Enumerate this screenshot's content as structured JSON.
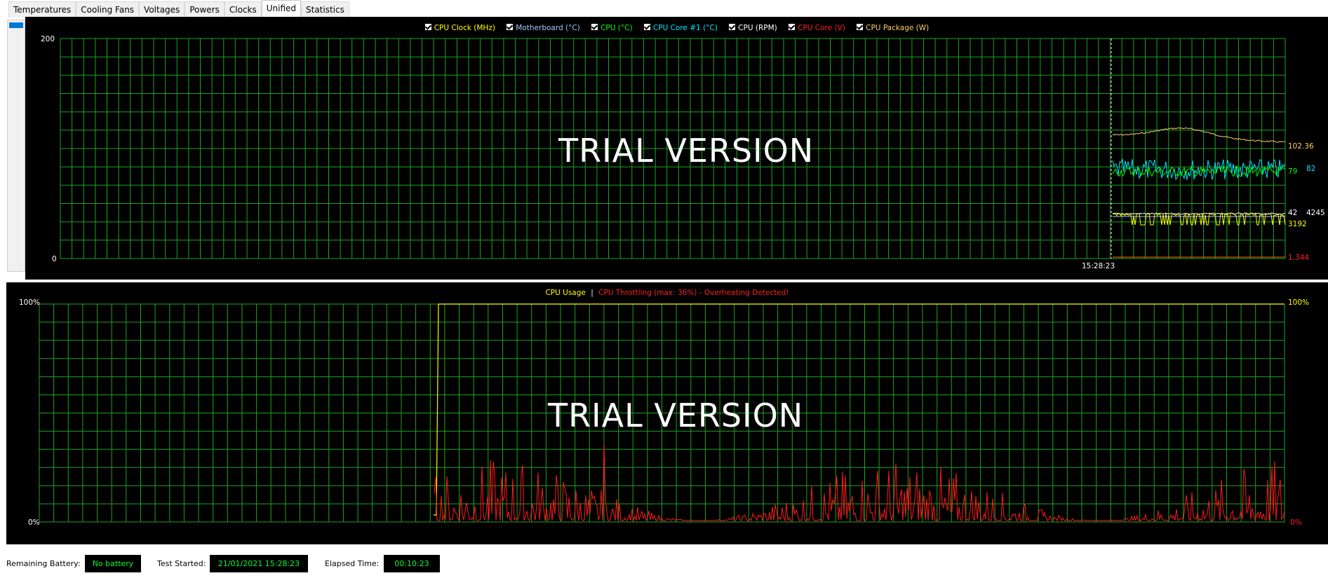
{
  "tabs": [
    {
      "label": "Temperatures"
    },
    {
      "label": "Cooling Fans"
    },
    {
      "label": "Voltages"
    },
    {
      "label": "Powers"
    },
    {
      "label": "Clocks"
    },
    {
      "label": "Unified"
    },
    {
      "label": "Statistics"
    }
  ],
  "active_tab": "Unified",
  "top_chart": {
    "legend": [
      {
        "label": "CPU Clock (MHz)",
        "color": "#ffff00"
      },
      {
        "label": "Motherboard (°C)",
        "color": "#a6c8ff"
      },
      {
        "label": "CPU (°C)",
        "color": "#00ff00"
      },
      {
        "label": "CPU Core #1 (°C)",
        "color": "#00e5ff"
      },
      {
        "label": "CPU (RPM)",
        "color": "#ffffff"
      },
      {
        "label": "CPU Core (V)",
        "color": "#ff2020"
      },
      {
        "label": "CPU Package (W)",
        "color": "#ffcc66"
      }
    ],
    "y_max_label": "200",
    "y_min_label": "0",
    "time_label": "15:28:23",
    "watermark": "TRIAL VERSION",
    "right_values": {
      "package_w": "102.36",
      "core1": "82",
      "cpu_c": "79",
      "rpm_value": "42",
      "rpm_extra": "4245",
      "clock": "3192",
      "voltage": "1.344"
    }
  },
  "bottom_chart": {
    "legend_usage": "CPU Usage",
    "legend_sep": "|",
    "legend_throttle": "CPU Throttling (max: 36%) - Overheating Detected!",
    "y_max_label": "100%",
    "y_min_label": "0%",
    "right_max": "100%",
    "right_min": "0%",
    "watermark": "TRIAL VERSION"
  },
  "status": {
    "battery_label": "Remaining Battery:",
    "battery_value": "No battery",
    "test_label": "Test Started:",
    "test_value": "21/01/2021 15:28:23",
    "elapsed_label": "Elapsed Time:",
    "elapsed_value": "00:10:23"
  }
}
